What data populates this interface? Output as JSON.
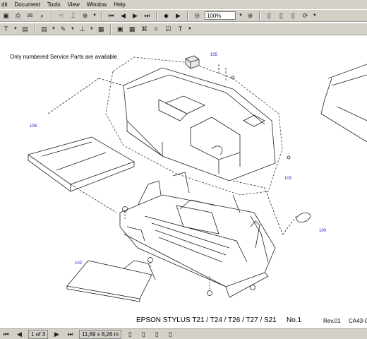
{
  "menubar": {
    "items": [
      "dit",
      "Document",
      "Tools",
      "View",
      "Window",
      "Help"
    ]
  },
  "toolbar": {
    "zoom_value": "100%"
  },
  "icons": [
    "save-icon",
    "print-icon",
    "email-icon",
    "search-icon",
    "hand-icon",
    "select-icon",
    "zoom-icon",
    "first-page-icon",
    "prev-page-icon",
    "next-page-icon",
    "last-page-icon",
    "back-icon",
    "forward-icon",
    "zoom-out-icon",
    "zoom-in-icon",
    "single-page-icon",
    "continuous-icon",
    "facing-icon",
    "rotate-icon",
    "text-select-icon",
    "note-icon",
    "pencil-icon",
    "stamp-icon",
    "highlight-icon",
    "image-icon",
    "table-icon",
    "text-icon"
  ],
  "document": {
    "note": "Only numbered Service Parts are available.",
    "title": "EPSON STYLUS T21 / T24 / T26 / T27 / S21",
    "page_no": "No.1",
    "rev": "Rev.01",
    "code": "CA43-C",
    "part_labels": {
      "p105": "105",
      "p108": "108",
      "p103": "103",
      "p100": "100",
      "p102": "102"
    }
  },
  "statusbar": {
    "page_indicator": "1 of 3",
    "page_size": "11,69 x 8,26 in"
  }
}
